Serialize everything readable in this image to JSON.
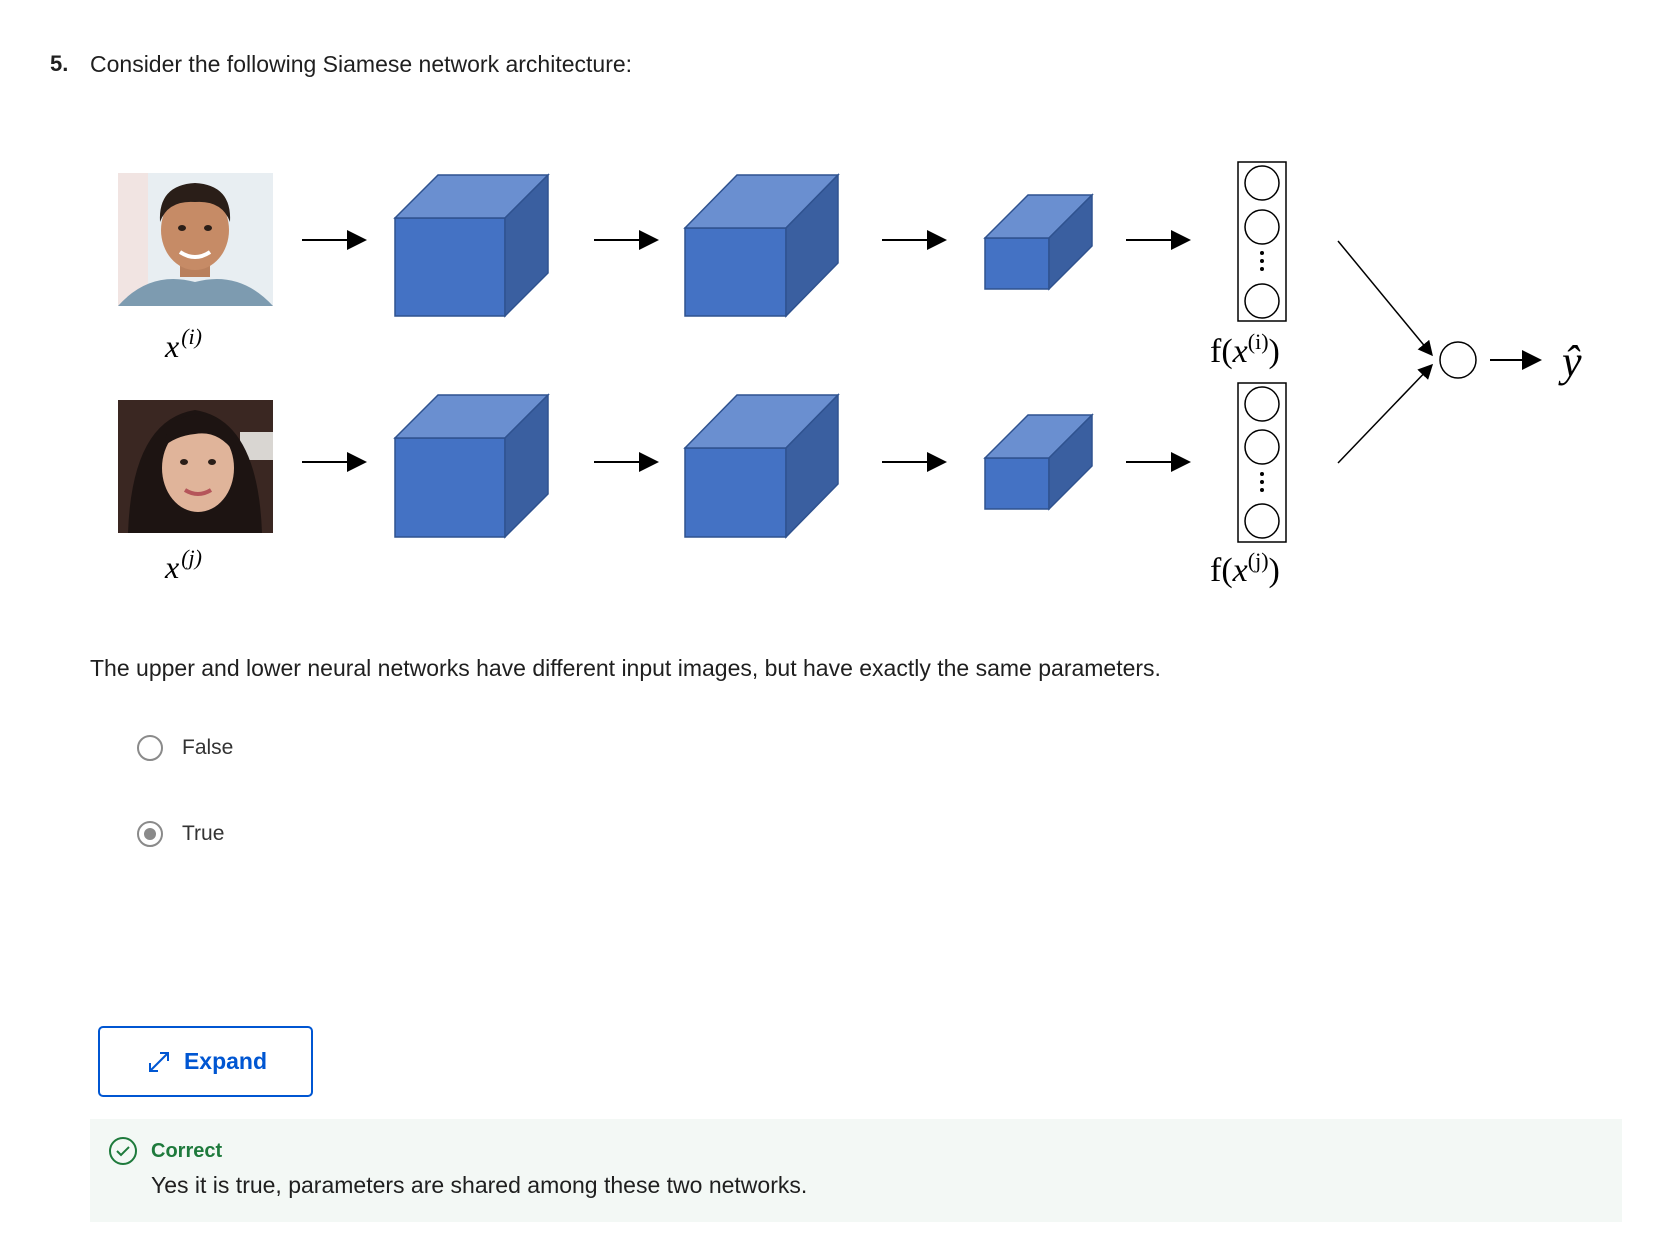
{
  "question": {
    "number": "5.",
    "prompt": "Consider the following Siamese network architecture:",
    "statement": "The upper and lower neural networks have different input images, but have exactly the same parameters."
  },
  "diagram": {
    "input_labels": [
      "x",
      "(i)",
      "x",
      "(j)"
    ],
    "encoding_labels": [
      "f(",
      "x",
      "(i)",
      ")",
      "f(",
      "x",
      "(j)",
      ")"
    ],
    "output_label": "ŷ",
    "colors": {
      "block_front": "#4472c4",
      "block_top": "#6a8fd0",
      "block_side": "#3a5fa0",
      "block_stroke": "#2f528f"
    }
  },
  "options": [
    {
      "label": "False",
      "selected": false
    },
    {
      "label": "True",
      "selected": true
    }
  ],
  "expand_button": {
    "label": "Expand",
    "icon": "expand-arrows-icon"
  },
  "feedback": {
    "status": "Correct",
    "icon": "check-circle-icon",
    "message": "Yes it is true, parameters are shared among these two networks.",
    "color": "#1e7a3c"
  }
}
